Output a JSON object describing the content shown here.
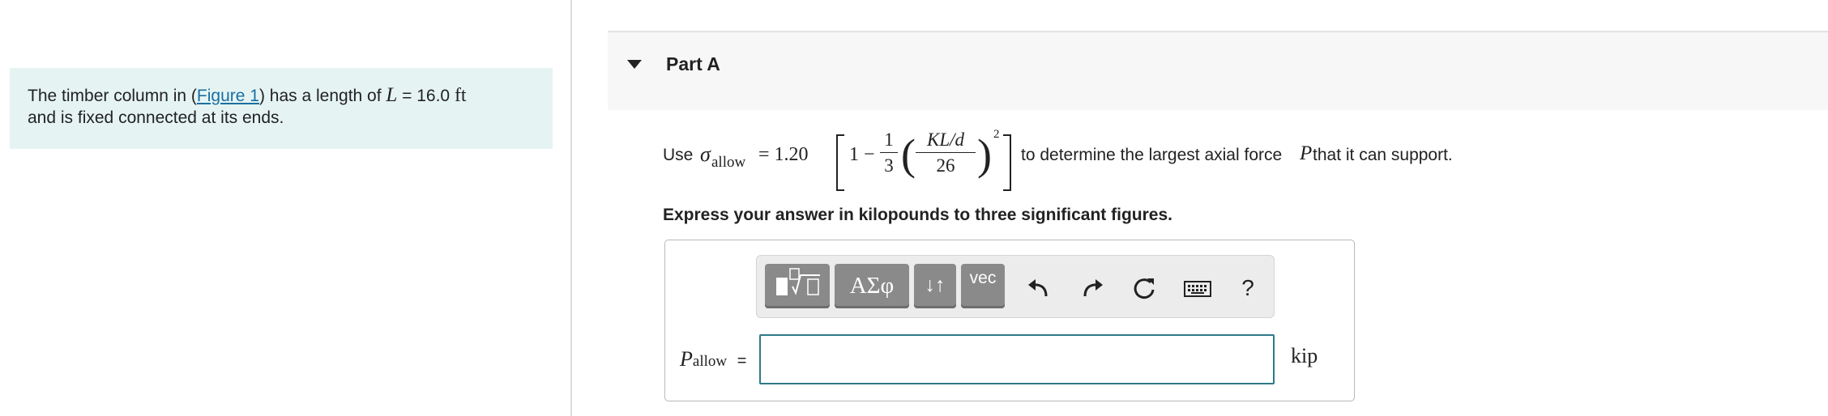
{
  "problem": {
    "text_before_link": "The timber column in (",
    "link": "Figure 1",
    "text_after_link": ") has a length of ",
    "length_symbol": "L",
    "length_value": " = 16.0 ",
    "length_unit": "ft",
    "line2": "and is fixed connected at its ends."
  },
  "part": {
    "title": "Part A"
  },
  "instruction": {
    "use": "Use ",
    "sigma": "σ",
    "sigma_sub": "allow",
    "equals": "= 1.20",
    "one_minus": "1 −",
    "frac1_num": "1",
    "frac1_den": "3",
    "frac2_num": "KL/d",
    "frac2_den": "26",
    "exponent": "2",
    "suffix_a": "to determine the largest axial force ",
    "force_symbol": "P",
    "suffix_b": " that it can support."
  },
  "express": "Express your answer in kilopounds to three significant figures.",
  "toolbar": {
    "buttons": [
      "template-icon",
      "ΑΣφ",
      "↓↑",
      "vec"
    ],
    "icons": [
      "undo-icon",
      "redo-icon",
      "reset-icon",
      "keyboard-icon",
      "?"
    ]
  },
  "answer": {
    "label_symbol": "P",
    "label_sub": "allow",
    "label_eq": "=",
    "value": "",
    "unit": "kip"
  }
}
